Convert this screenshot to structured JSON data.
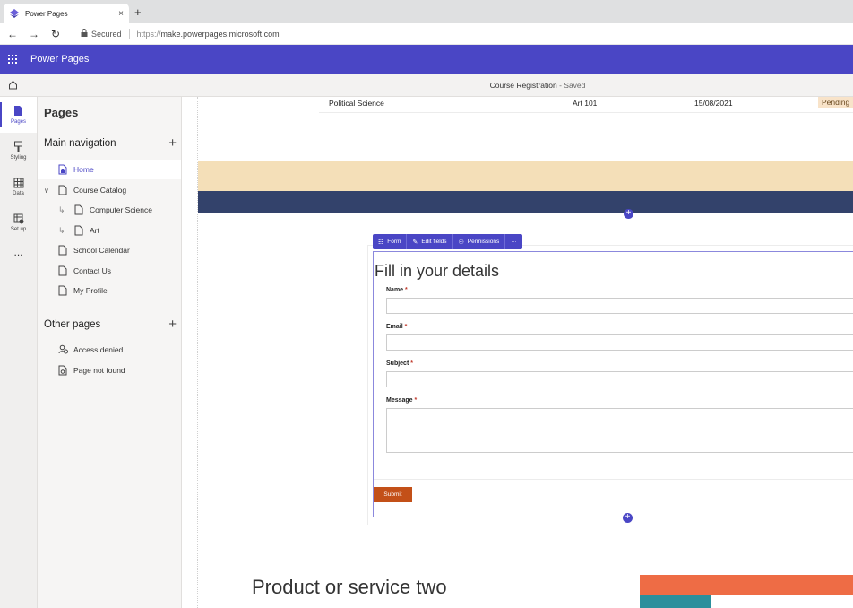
{
  "browser": {
    "tab_title": "Power Pages",
    "tab_close": "×",
    "new_tab": "+",
    "secured_label": "Secured",
    "url_scheme": "https://",
    "url_host": "make.powerpages.microsoft.com"
  },
  "app": {
    "name": "Power Pages",
    "site_name": "Course Registration",
    "site_status": " - Saved"
  },
  "rail": {
    "items": [
      {
        "label": "Pages"
      },
      {
        "label": "Styling"
      },
      {
        "label": "Data"
      },
      {
        "label": "Set up"
      }
    ],
    "more": "..."
  },
  "panel": {
    "title": "Pages",
    "main_nav_title": "Main navigation",
    "other_pages_title": "Other pages",
    "add": "+",
    "main_items": [
      {
        "label": "Home"
      },
      {
        "label": "Course Catalog"
      },
      {
        "label": "Computer Science"
      },
      {
        "label": "Art"
      },
      {
        "label": "School Calendar"
      },
      {
        "label": "Contact Us"
      },
      {
        "label": "My Profile"
      }
    ],
    "other_items": [
      {
        "label": "Access denied"
      },
      {
        "label": "Page not found"
      }
    ]
  },
  "table_row": {
    "subject": "Political Science",
    "course": "Art 101",
    "date": "15/08/2021",
    "status": "Pending"
  },
  "form_toolbar": {
    "form": "Form",
    "edit_fields": "Edit fields",
    "permissions": "Permissions",
    "more": "···"
  },
  "form": {
    "title": "Fill in your details",
    "required_mark": " *",
    "fields": [
      {
        "label": "Name"
      },
      {
        "label": "Email"
      },
      {
        "label": "Subject"
      },
      {
        "label": "Message"
      }
    ],
    "submit": "Submit"
  },
  "product": {
    "title": "Product or service two"
  },
  "colors": {
    "brand": "#4a46c5",
    "submit": "#c35018",
    "band_peach": "#f4dfb8",
    "band_navy": "#33426b",
    "accent_orange": "#ee6c45",
    "accent_teal": "#2b8f9c"
  }
}
